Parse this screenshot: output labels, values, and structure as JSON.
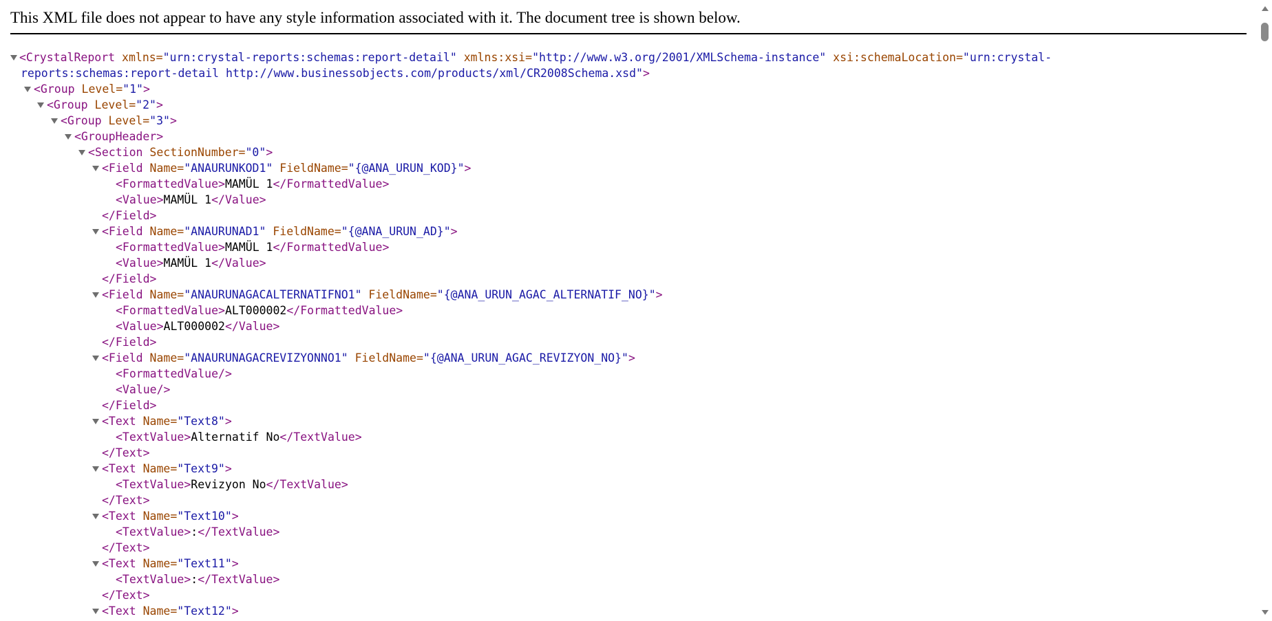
{
  "header_text": "This XML file does not appear to have any style information associated with it. The document tree is shown below.",
  "root": {
    "line1": {
      "open": "<CrystalReport",
      "a1": " xmlns=",
      "v1": "\"urn:crystal-reports:schemas:report-detail\"",
      "a2": " xmlns:xsi=",
      "v2": "\"http://www.w3.org/2001/XMLSchema-instance\"",
      "a3": " xsi:schemaLocation=",
      "v3": "\"urn:crystal-"
    },
    "line2": {
      "v": "reports:schemas:report-detail http://www.businessobjects.com/products/xml/CR2008Schema.xsd\"",
      "close": ">"
    }
  },
  "group1": {
    "open": "<Group",
    "attr": " Level=",
    "val": "\"1\"",
    "close": ">"
  },
  "group2": {
    "open": "<Group",
    "attr": " Level=",
    "val": "\"2\"",
    "close": ">"
  },
  "group3": {
    "open": "<Group",
    "attr": " Level=",
    "val": "\"3\"",
    "close": ">"
  },
  "groupheader": {
    "tag": "<GroupHeader>"
  },
  "section": {
    "open": "<Section",
    "attr": " SectionNumber=",
    "val": "\"0\"",
    "close": ">"
  },
  "fields": [
    {
      "open": "<Field",
      "a1": " Name=",
      "v1": "\"ANAURUNKOD1\"",
      "a2": " FieldName=",
      "v2": "\"{@ANA_URUN_KOD}\"",
      "close": ">",
      "fv_open": "<FormattedValue>",
      "fv_text": "MAMÜL 1",
      "fv_close": "</FormattedValue>",
      "v_open": "<Value>",
      "v_text": "MAMÜL 1",
      "v_close": "</Value>",
      "end": "</Field>"
    },
    {
      "open": "<Field",
      "a1": " Name=",
      "v1": "\"ANAURUNAD1\"",
      "a2": " FieldName=",
      "v2": "\"{@ANA_URUN_AD}\"",
      "close": ">",
      "fv_open": "<FormattedValue>",
      "fv_text": "MAMÜL 1",
      "fv_close": "</FormattedValue>",
      "v_open": "<Value>",
      "v_text": "MAMÜL 1",
      "v_close": "</Value>",
      "end": "</Field>"
    },
    {
      "open": "<Field",
      "a1": " Name=",
      "v1": "\"ANAURUNAGACALTERNATIFNO1\"",
      "a2": " FieldName=",
      "v2": "\"{@ANA_URUN_AGAC_ALTERNATIF_NO}\"",
      "close": ">",
      "fv_open": "<FormattedValue>",
      "fv_text": "ALT000002",
      "fv_close": "</FormattedValue>",
      "v_open": "<Value>",
      "v_text": "ALT000002",
      "v_close": "</Value>",
      "end": "</Field>"
    },
    {
      "open": "<Field",
      "a1": " Name=",
      "v1": "\"ANAURUNAGACREVIZYONNO1\"",
      "a2": " FieldName=",
      "v2": "\"{@ANA_URUN_AGAC_REVIZYON_NO}\"",
      "close": ">",
      "fv_empty": "<FormattedValue/>",
      "v_empty": "<Value/>",
      "end": "</Field>"
    }
  ],
  "texts": [
    {
      "open": "<Text",
      "attr": " Name=",
      "val": "\"Text8\"",
      "close": ">",
      "tv_open": "<TextValue>",
      "tv_text": "Alternatif No",
      "tv_close": "</TextValue>",
      "end": "</Text>"
    },
    {
      "open": "<Text",
      "attr": " Name=",
      "val": "\"Text9\"",
      "close": ">",
      "tv_open": "<TextValue>",
      "tv_text": "Revizyon No",
      "tv_close": "</TextValue>",
      "end": "</Text>"
    },
    {
      "open": "<Text",
      "attr": " Name=",
      "val": "\"Text10\"",
      "close": ">",
      "tv_open": "<TextValue>",
      "tv_text": ":",
      "tv_close": "</TextValue>",
      "end": "</Text>"
    },
    {
      "open": "<Text",
      "attr": " Name=",
      "val": "\"Text11\"",
      "close": ">",
      "tv_open": "<TextValue>",
      "tv_text": ":",
      "tv_close": "</TextValue>",
      "end": "</Text>"
    },
    {
      "open": "<Text",
      "attr": " Name=",
      "val": "\"Text12\"",
      "close": ">"
    }
  ],
  "colors": {
    "tag": "#881280",
    "attribute": "#994500",
    "value": "#1a1aa6",
    "text": "#000000",
    "toggle": "#6e6e6e"
  },
  "icons": {
    "expand_toggle": "collapse-triangle-icon",
    "scroll_up": "scroll-up-arrow-icon",
    "scroll_down": "scroll-down-arrow-icon"
  }
}
